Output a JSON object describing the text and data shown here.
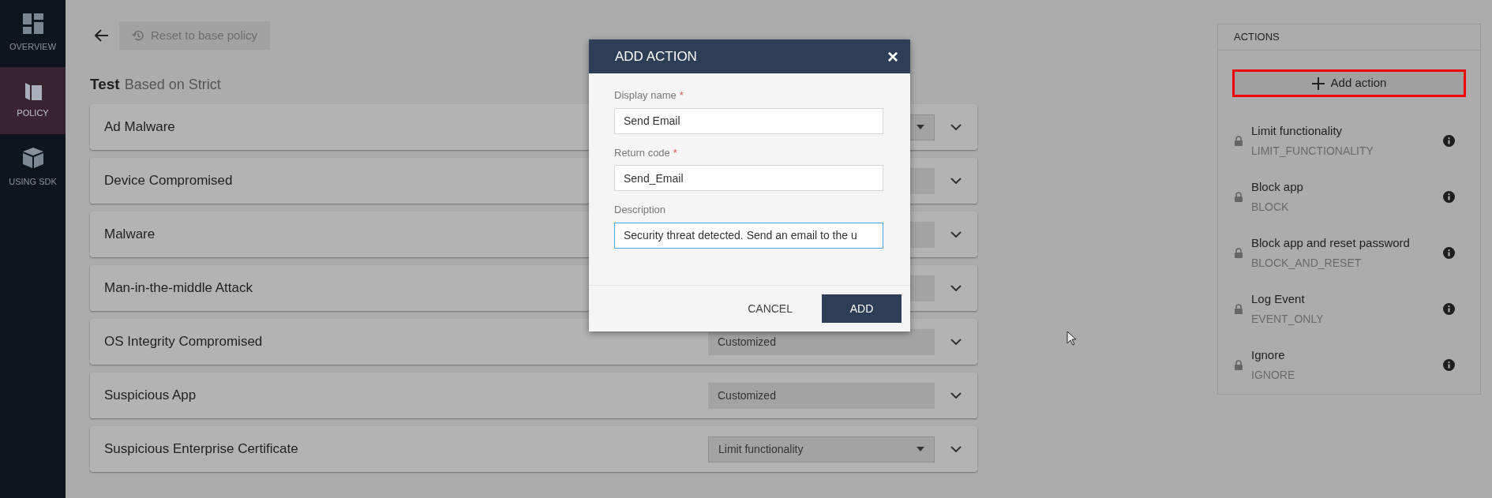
{
  "sidebar": {
    "items": [
      {
        "label": "OVERVIEW",
        "selected": false
      },
      {
        "label": "POLICY",
        "selected": true
      },
      {
        "label": "USING SDK",
        "selected": false
      }
    ]
  },
  "toolbar": {
    "reset_button": "Reset to base policy"
  },
  "policy": {
    "name": "Test",
    "based_on": "Based on Strict"
  },
  "threats": [
    {
      "name": "Ad Malware",
      "kind": "select"
    },
    {
      "name": "Device Compromised",
      "kind": "static"
    },
    {
      "name": "Malware",
      "kind": "static"
    },
    {
      "name": "Man-in-the-middle Attack",
      "kind": "static"
    },
    {
      "name": "OS Integrity Compromised",
      "kind": "static",
      "value": "Customized"
    },
    {
      "name": "Suspicious App",
      "kind": "static",
      "value": "Customized"
    },
    {
      "name": "Suspicious Enterprise Certificate",
      "kind": "select",
      "value": "Limit functionality"
    }
  ],
  "dialog": {
    "title": "ADD ACTION",
    "close": "×",
    "fields": [
      {
        "label": "Display name",
        "required_mark": "*",
        "value": "Send Email",
        "focused": false
      },
      {
        "label": "Return code",
        "required_mark": "*",
        "value": "Send_Email",
        "focused": false
      },
      {
        "label": "Description",
        "value": "Security threat detected. Send an email to the u",
        "focused": true
      }
    ],
    "cancel": "CANCEL",
    "confirm": "ADD"
  },
  "actions_panel": {
    "title": "ACTIONS",
    "add_button": "Add action",
    "items": [
      {
        "name": "Limit functionality",
        "code": "LIMIT_FUNCTIONALITY",
        "locked": true
      },
      {
        "name": "Block app",
        "code": "BLOCK",
        "locked": true
      },
      {
        "name": "Block app and reset password",
        "code": "BLOCK_AND_RESET",
        "locked": true
      },
      {
        "name": "Log Event",
        "code": "EVENT_ONLY",
        "locked": true
      },
      {
        "name": "Ignore",
        "code": "IGNORE",
        "locked": true
      }
    ]
  }
}
